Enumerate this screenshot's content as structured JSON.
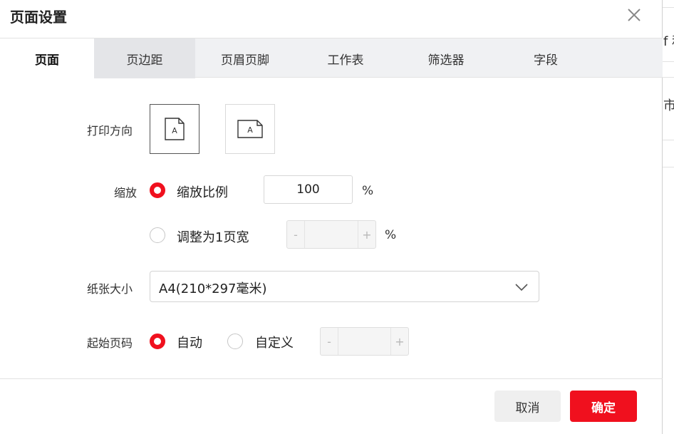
{
  "dialog": {
    "title": "页面设置",
    "close_icon": "close-icon"
  },
  "tabs": [
    {
      "label": "页面",
      "active": true
    },
    {
      "label": "页边距"
    },
    {
      "label": "页眉页脚"
    },
    {
      "label": "工作表"
    },
    {
      "label": "筛选器"
    },
    {
      "label": "字段"
    }
  ],
  "orientation": {
    "label": "打印方向",
    "portrait_glyph": "A",
    "landscape_glyph": "A",
    "selected": "portrait"
  },
  "scale": {
    "label": "缩放",
    "option_ratio_label": "缩放比例",
    "ratio_value": "100",
    "ratio_unit": "%",
    "option_fit_label": "调整为1页宽",
    "fit_minus": "-",
    "fit_plus": "+",
    "fit_unit": "%",
    "selected": "ratio"
  },
  "paper": {
    "label": "纸张大小",
    "value": "A4(210*297毫米)"
  },
  "start_page": {
    "label": "起始页码",
    "option_auto_label": "自动",
    "option_custom_label": "自定义",
    "minus": "-",
    "plus": "+",
    "selected": "auto"
  },
  "footer": {
    "cancel_label": "取消",
    "ok_label": "确定"
  },
  "background": {
    "snippet_1": "f 和",
    "snippet_2": "市"
  },
  "colors": {
    "accent": "#f0101e",
    "tab_bar": "#f0f1f3"
  }
}
